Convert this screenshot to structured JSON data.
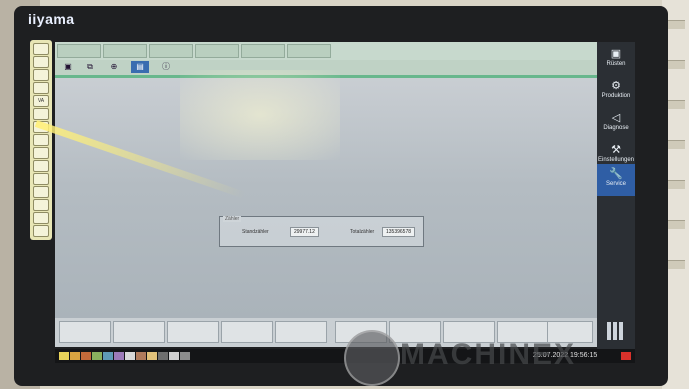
{
  "bezel": {
    "brand": "iiyama"
  },
  "keypad": {
    "keys": [
      "",
      "",
      "",
      "",
      "VA",
      "",
      "",
      "",
      "",
      "",
      "",
      "",
      "",
      "",
      ""
    ]
  },
  "screen": {
    "top_tabs": [
      "",
      "",
      "",
      "",
      "",
      ""
    ],
    "sub_icons": [
      "",
      "",
      "",
      "",
      ""
    ],
    "counters": {
      "group_label": "Zähler",
      "items": [
        {
          "label": "Standzähler",
          "value": "29977.12"
        },
        {
          "label": "Totalzähler",
          "value": "135396578"
        }
      ]
    },
    "function_keys": [
      "",
      "",
      "",
      "",
      "",
      "",
      "",
      "",
      "",
      ""
    ]
  },
  "sidebar": {
    "items": [
      {
        "label": "Rüsten",
        "icon": "recipe-icon"
      },
      {
        "label": "Produktion",
        "icon": "production-icon"
      },
      {
        "label": "Diagnose",
        "icon": "speaker-icon"
      },
      {
        "label": "Einstellungen",
        "icon": "settings-icon"
      },
      {
        "label": "Service",
        "icon": "wrench-icon"
      }
    ],
    "active_index": 4,
    "active_color": "#2f5ea5"
  },
  "statusbar": {
    "datetime": "25.07.2022 19:56:15",
    "alarm_color": "#d9312b"
  },
  "watermark": {
    "text": "MACHINEX"
  }
}
